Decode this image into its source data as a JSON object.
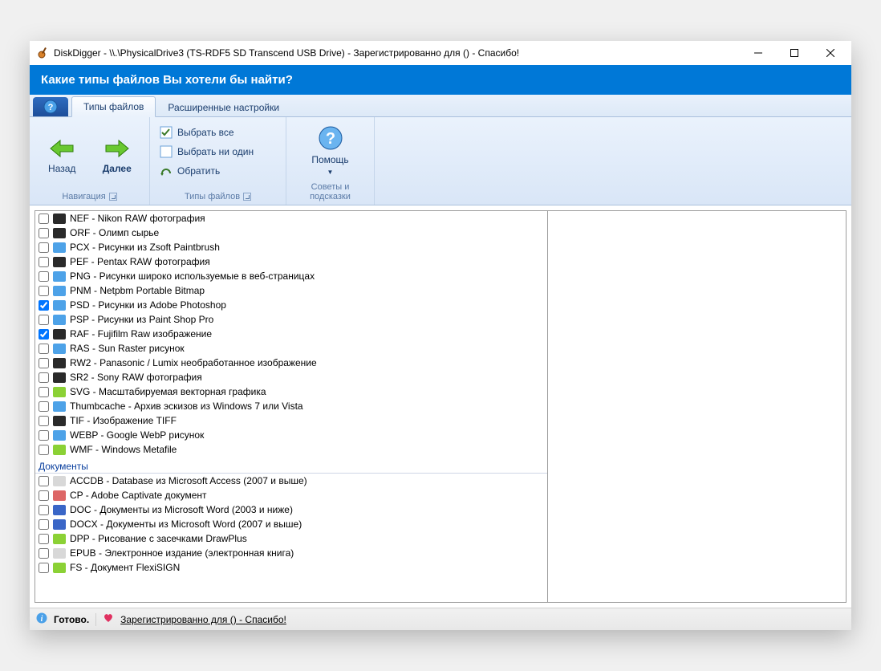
{
  "title": "DiskDigger - \\\\.\\PhysicalDrive3 (TS-RDF5 SD  Transcend USB Drive) - Зарегистрированно для  () - Спасибо!",
  "banner": "Какие типы файлов Вы хотели бы найти?",
  "tabs": {
    "t0": "Типы файлов",
    "t1": "Расширенные настройки"
  },
  "nav": {
    "back": "Назад",
    "next": "Далее",
    "group": "Навигация"
  },
  "sel": {
    "all": "Выбрать все",
    "none": "Выбрать ни один",
    "invert": "Обратить",
    "group": "Типы файлов"
  },
  "help": {
    "btn": "Помощь",
    "group": "Советы и подсказки"
  },
  "categories": {
    "docs": "Документы"
  },
  "rows": [
    {
      "chk": false,
      "color": "#2a2a2a",
      "label": "NEF - Nikon RAW фотография"
    },
    {
      "chk": false,
      "color": "#2a2a2a",
      "label": "ORF - Олимп сырье"
    },
    {
      "chk": false,
      "color": "#4da2e8",
      "label": "PCX - Рисунки из Zsoft Paintbrush"
    },
    {
      "chk": false,
      "color": "#2a2a2a",
      "label": "PEF - Pentax RAW фотография"
    },
    {
      "chk": false,
      "color": "#4da2e8",
      "label": "PNG - Рисунки широко используемые в веб-страницах"
    },
    {
      "chk": false,
      "color": "#4da2e8",
      "label": "PNM - Netpbm Portable Bitmap"
    },
    {
      "chk": true,
      "color": "#4da2e8",
      "label": "PSD - Рисунки из Adobe Photoshop"
    },
    {
      "chk": false,
      "color": "#4da2e8",
      "label": "PSP - Рисунки из Paint Shop Pro"
    },
    {
      "chk": true,
      "color": "#2a2a2a",
      "label": "RAF - Fujifilm Raw изображение"
    },
    {
      "chk": false,
      "color": "#4da2e8",
      "label": "RAS - Sun Raster рисунок"
    },
    {
      "chk": false,
      "color": "#2a2a2a",
      "label": "RW2 - Panasonic / Lumix необработанное изображение"
    },
    {
      "chk": false,
      "color": "#2a2a2a",
      "label": "SR2 - Sony RAW фотография"
    },
    {
      "chk": false,
      "color": "#8bd135",
      "label": "SVG - Масштабируемая векторная графика"
    },
    {
      "chk": false,
      "color": "#4da2e8",
      "label": "Thumbcache - Архив эскизов из Windows 7 или Vista"
    },
    {
      "chk": false,
      "color": "#2a2a2a",
      "label": "TIF - Изображение TIFF"
    },
    {
      "chk": false,
      "color": "#4da2e8",
      "label": "WEBP - Google WebP рисунок"
    },
    {
      "chk": false,
      "color": "#8bd135",
      "label": "WMF - Windows Metafile"
    }
  ],
  "docs": [
    {
      "chk": false,
      "color": "#d8d8d8",
      "label": "ACCDB - Database из Microsoft Access (2007 и выше)"
    },
    {
      "chk": false,
      "color": "#d66",
      "label": "CP - Adobe Captivate документ"
    },
    {
      "chk": false,
      "color": "#3a66c7",
      "label": "DOC - Документы из Microsoft Word (2003 и ниже)"
    },
    {
      "chk": false,
      "color": "#3a66c7",
      "label": "DOCX - Документы из Microsoft Word (2007 и выше)"
    },
    {
      "chk": false,
      "color": "#8bd135",
      "label": "DPP - Рисование с засечками DrawPlus"
    },
    {
      "chk": false,
      "color": "#d8d8d8",
      "label": "EPUB - Электронное издание (электронная книга)"
    },
    {
      "chk": false,
      "color": "#8bd135",
      "label": "FS - Документ FlexiSIGN"
    }
  ],
  "status": {
    "ready": "Готово.",
    "reg": "Зарегистрированно для  () - Спасибо!"
  }
}
